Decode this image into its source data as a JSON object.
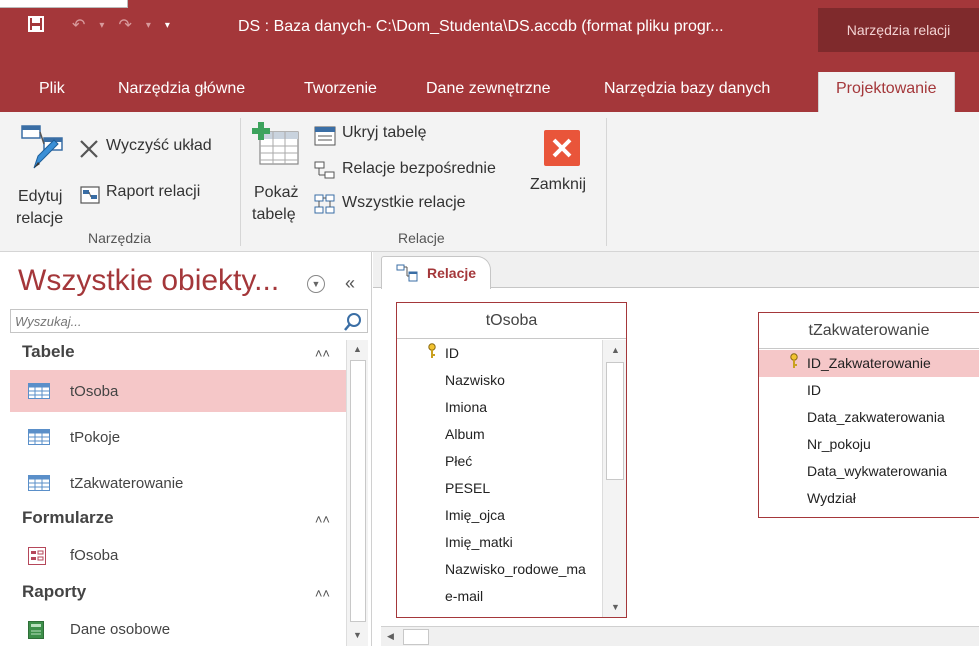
{
  "window": {
    "title": "DS : Baza danych- C:\\Dom_Studenta\\DS.accdb (format pliku progr...",
    "context_tab_header": "Narzędzia relacji"
  },
  "ribbon": {
    "tabs": [
      {
        "label": "Plik"
      },
      {
        "label": "Narzędzia główne"
      },
      {
        "label": "Tworzenie"
      },
      {
        "label": "Dane zewnętrzne"
      },
      {
        "label": "Narzędzia bazy danych"
      },
      {
        "label": "Projektowanie",
        "active": true
      }
    ],
    "groups": {
      "narzedzia": {
        "label": "Narzędzia",
        "edit_relations": {
          "line1": "Edytuj",
          "line2": "relacje"
        },
        "clear_layout": "Wyczyść układ",
        "relations_report": "Raport relacji"
      },
      "relacje": {
        "label": "Relacje",
        "show_table": {
          "line1": "Pokaż",
          "line2": "tabelę"
        },
        "hide_table": "Ukryj tabelę",
        "direct_relations": "Relacje bezpośrednie",
        "all_relations": "Wszystkie relacje",
        "close": "Zamknij"
      }
    }
  },
  "nav": {
    "title": "Wszystkie obiekty...",
    "search_placeholder": "Wyszukaj...",
    "sections": [
      {
        "label": "Tabele",
        "items": [
          "tOsoba",
          "tPokoje",
          "tZakwaterowanie"
        ],
        "selected": "tOsoba"
      },
      {
        "label": "Formularze",
        "items": [
          "fOsoba"
        ]
      },
      {
        "label": "Raporty",
        "items": [
          "Dane osobowe"
        ]
      }
    ]
  },
  "document": {
    "tab_label": "Relacje",
    "tables": [
      {
        "name": "tOsoba",
        "fields": [
          "ID",
          "Nazwisko",
          "Imiona",
          "Album",
          "Płeć",
          "PESEL",
          "Imię_ojca",
          "Imię_matki",
          "Nazwisko_rodowe_ma",
          "e-mail"
        ],
        "primary_key": "ID"
      },
      {
        "name": "tZakwaterowanie",
        "fields": [
          "ID_Zakwaterowanie",
          "ID",
          "Data_zakwaterowania",
          "Nr_pokoju",
          "Data_wykwaterowania",
          "Wydział"
        ],
        "primary_key": "ID_Zakwaterowanie"
      }
    ]
  },
  "colors": {
    "accent": "#a4373a",
    "accent_dark": "#7f2a2c",
    "selection": "#f5c7c8",
    "close_button": "#e9553a"
  }
}
